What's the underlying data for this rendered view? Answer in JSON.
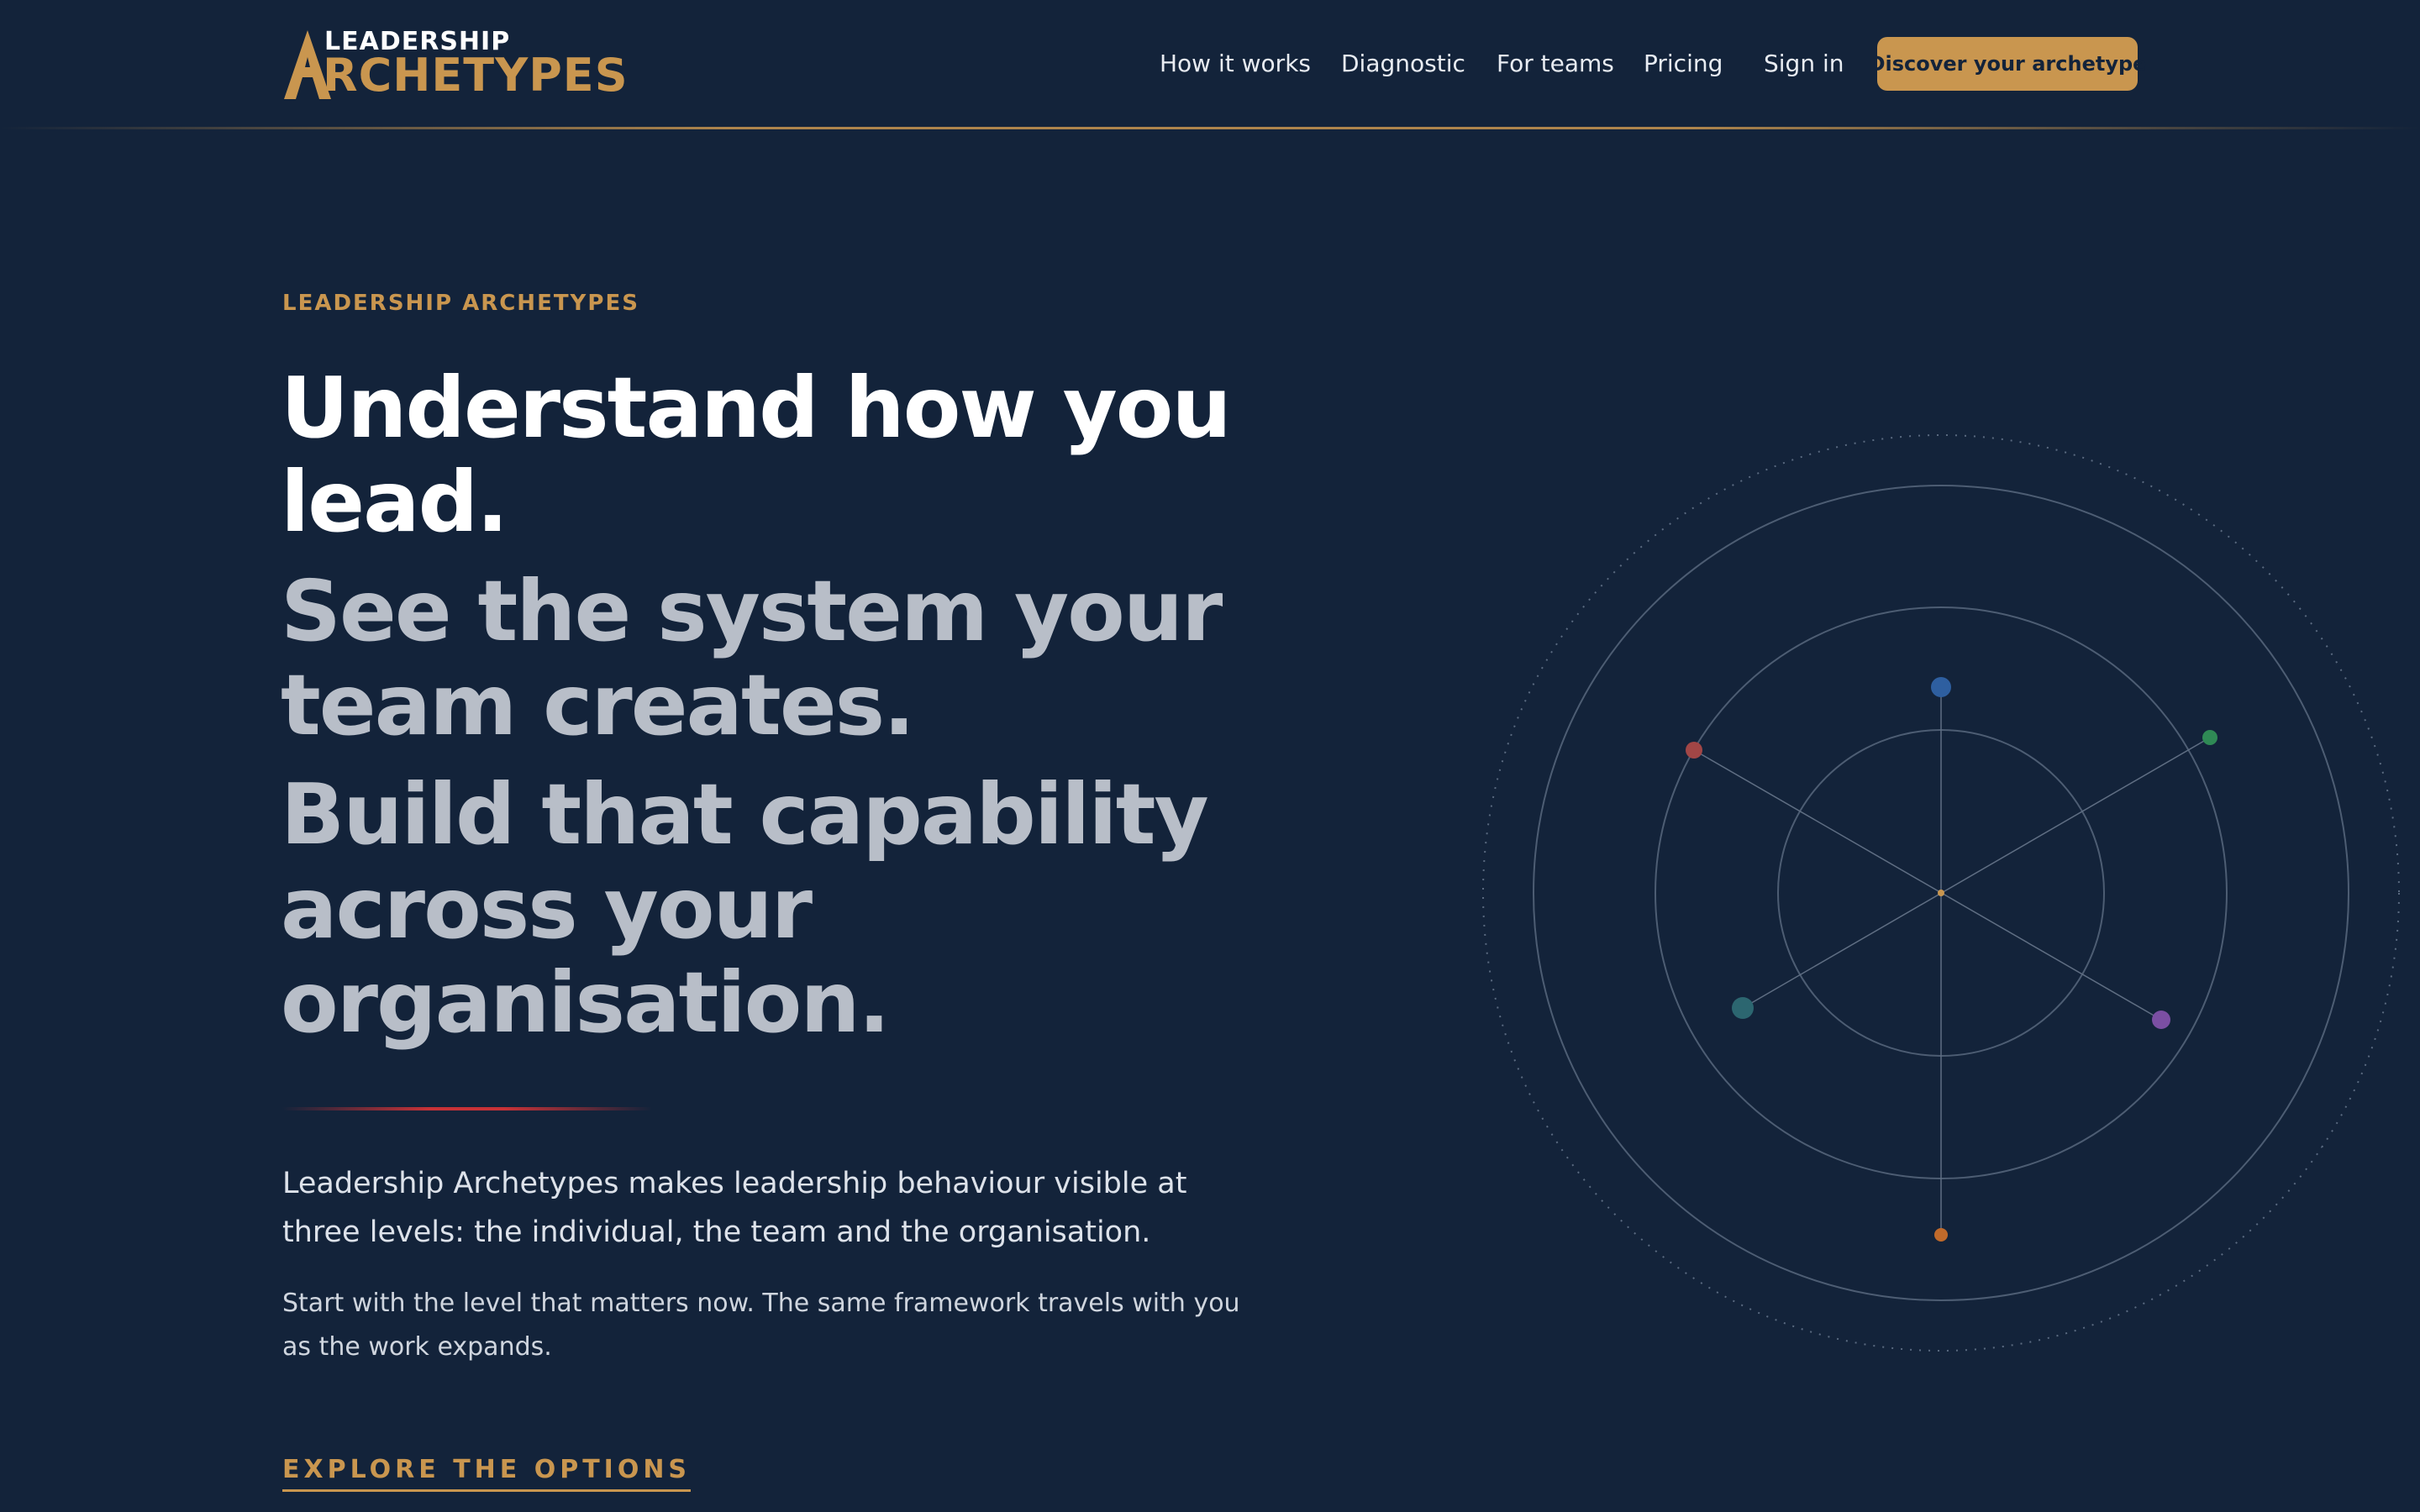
{
  "brand": {
    "logo_top": "LEADERSHIP",
    "logo_bottom": "ARCHETYPES",
    "accent": "#c9964f",
    "background": "#13233a"
  },
  "nav": {
    "items": [
      "How it works",
      "Diagnostic",
      "For teams",
      "Pricing",
      "Sign in"
    ],
    "cta": "Discover your archetype"
  },
  "hero": {
    "eyebrow": "LEADERSHIP ARCHETYPES",
    "line1": "Understand how you lead.",
    "line2": "See the system your team creates.",
    "line3": "Build that capability across your organisation.",
    "lede": "Leadership Archetypes makes leadership behaviour visible at three levels: the individual, the team and the organisation.",
    "sub": "Start with the level that matters now. The same framework travels with you as the work expands.",
    "explore": "EXPLORE THE OPTIONS"
  },
  "diagram": {
    "node_colors": [
      "#2e5fa0",
      "#2f8a55",
      "#7b4fa3",
      "#c06a2b",
      "#2c6670",
      "#a14646"
    ],
    "center_color": "#c9964f"
  }
}
